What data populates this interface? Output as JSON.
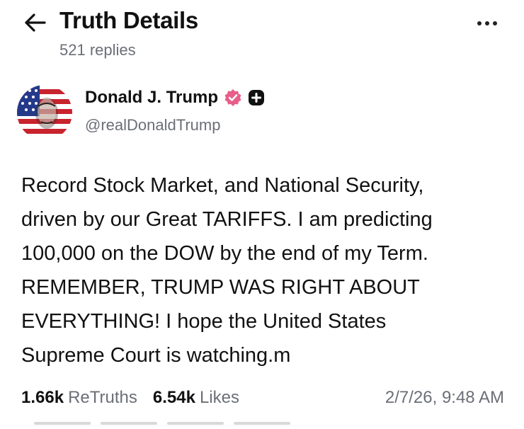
{
  "header": {
    "title": "Truth Details",
    "replies": "521 replies"
  },
  "author": {
    "name": "Donald J. Trump",
    "handle": "@realDonaldTrump",
    "verified_color": "#e85d8a"
  },
  "post": {
    "text": "Record Stock Market, and National Security,\ndriven by our Great TARIFFS. I am predicting\n100,000 on the DOW by the end of my Term.\nREMEMBER, TRUMP WAS RIGHT ABOUT\nEVERYTHING! I hope the United States\nSupreme Court is watching.m"
  },
  "stats": {
    "retruths_count": "1.66k",
    "retruths_label": "ReTruths",
    "likes_count": "6.54k",
    "likes_label": "Likes",
    "timestamp": "2/7/26, 9:48 AM"
  },
  "icons": {
    "back": "arrow-left-icon",
    "more": "more-horizontal-icon",
    "verified": "verified-badge-icon",
    "plus": "plus-badge-icon"
  }
}
